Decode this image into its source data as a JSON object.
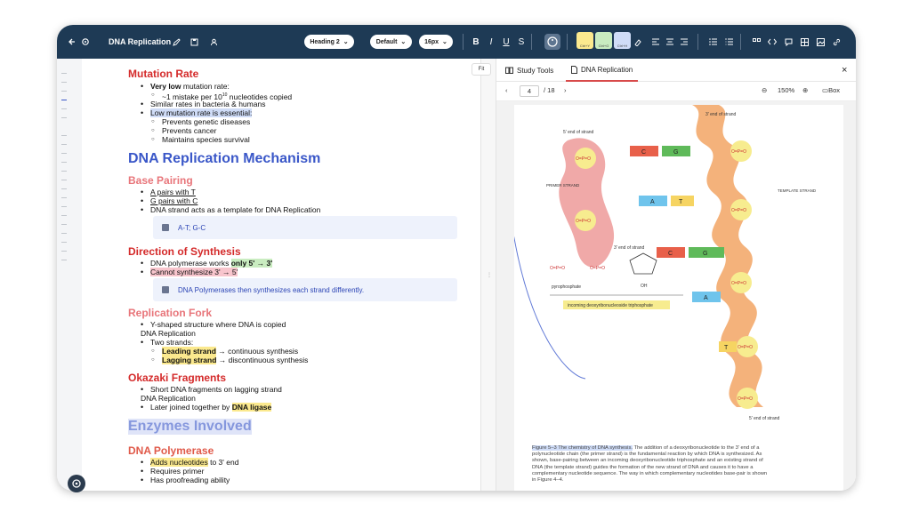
{
  "toolbar": {
    "doc_title": "DNA Replication",
    "style_select": "Heading 2",
    "font_select": "Default",
    "size_select": "16px",
    "bold": "B",
    "italic": "I",
    "underline": "U",
    "strike": "S",
    "swatches": [
      {
        "label": "Ctrl+Y",
        "color": "#fbe98e"
      },
      {
        "label": "Ctrl+G",
        "color": "#c9ecc0"
      },
      {
        "label": "Ctrl+H",
        "color": "#cfdcf7"
      }
    ],
    "icons": [
      "back-icon",
      "settings-icon",
      "edit-icon",
      "save-icon",
      "user-icon",
      "palette-icon",
      "eraser-icon",
      "align-left-icon",
      "align-center-icon",
      "align-right-icon",
      "bullet-list-icon",
      "numbered-list-icon",
      "quote-icon",
      "code-icon",
      "comment-icon",
      "table-icon",
      "image-icon",
      "link-icon"
    ],
    "colors": {
      "bg": "#1e3a55",
      "accent": "#3a57c8"
    }
  },
  "editor": {
    "fit_label": "Fit",
    "sec1": {
      "heading": "Mutation Rate",
      "b1_bold": "Very low",
      "b1_rest": " mutation rate:",
      "s1": "~1 mistake per 10",
      "s1_sup": "10",
      "s1_rest": " nucleotides copied",
      "b2": "Similar rates in bacteria & humans",
      "b3": "Low mutation rate is essential:",
      "s2": "Prevents genetic diseases",
      "s3": "Prevents cancer",
      "s4": "Maintains species survival"
    },
    "h1_mechanism": "DNA Replication Mechanism",
    "sec2": {
      "heading": "Base Pairing",
      "b1": "A pairs with T",
      "b2": "G pairs with C",
      "b3": "DNA strand acts as a template for DNA Replication",
      "callout": "A-T; G-C"
    },
    "sec3": {
      "heading": "Direction of Synthesis",
      "b1_pre": "DNA polymerase works ",
      "b1_hl": "only 5' → 3'",
      "b2": "Cannot synthesize 3' → 5'",
      "callout": "DNA Polymerases then synthesizes each strand differently."
    },
    "sec4": {
      "heading": "Replication Fork",
      "b1": "Y-shaped structure where DNA is copied",
      "l2": "DNA Replication",
      "b3": "Two strands:",
      "s1_hl": "Leading strand",
      "s1_rest": " → continuous synthesis",
      "s2_hl": "Lagging strand",
      "s2_rest": " → discontinuous synthesis"
    },
    "sec5": {
      "heading": "Okazaki Fragments",
      "b1": "Short DNA fragments on lagging strand",
      "l2": "DNA Replication",
      "b3_pre": "Later joined together by ",
      "b3_hl": "DNA ligase"
    },
    "h1_enzymes": "Enzymes Involved",
    "sec6": {
      "heading": "DNA Polymerase",
      "b1_hl": "Adds nucleotides",
      "b1_rest": " to 3' end",
      "b2": "Requires primer",
      "b3": "Has proofreading ability"
    }
  },
  "panel": {
    "tab1": "Study Tools",
    "tab2": "DNA Replication",
    "close": "×",
    "page_current": "4",
    "page_total": "/ 18",
    "zoom": "150%",
    "box_label": "Box",
    "figure": {
      "top_label_right": "3' end of strand",
      "top_label_left": "5' end of strand",
      "primer_label": "PRIMER STRAND",
      "template_label": "TEMPLATE STRAND",
      "three_end_mid": "3' end of strand",
      "pyrophosphate": "pyrophosphate",
      "incoming": "incoming deoxyribonucleoside triphosphate",
      "bottom_label": "5' end of strand",
      "bases": [
        "C",
        "G",
        "A",
        "T",
        "C",
        "G",
        "A",
        "T"
      ],
      "phosphate_text": "O=P=O",
      "oh": "OH"
    },
    "caption_hl": "Figure 5–3 The chemistry of DNA synthesis.",
    "caption_rest": " The addition of a deoxyribonucleotide to the 3' end of a polynucleotide chain (the primer strand) is the fundamental reaction by which DNA is synthesized. As shown, base-pairing between an incoming deoxyribonucleotide triphosphate and an existing strand of DNA (the template strand) guides the formation of the new strand of DNA and causes it to have a complementary nucleotide sequence. The way in which complementary nucleotides base-pair is shown in Figure 4–4."
  }
}
